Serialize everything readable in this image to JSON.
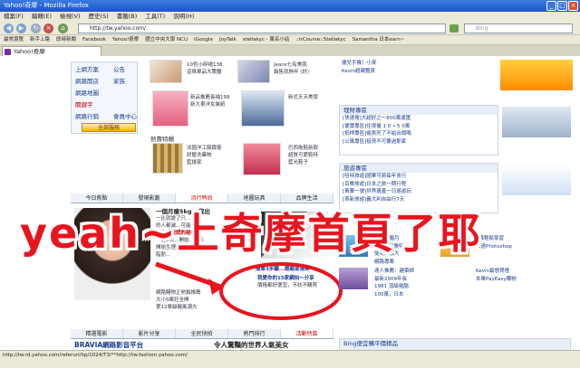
{
  "window": {
    "title": "Yahoo!奇摩 - Mozilla Firefox"
  },
  "menu": [
    "檔案(F)",
    "編輯(E)",
    "檢視(V)",
    "歷史(S)",
    "書籤(B)",
    "工具(T)",
    "說明(H)"
  ],
  "nav": {
    "url": "http://tw.yahoo.com/",
    "search_placeholder": "Bing"
  },
  "bookmarks": [
    "最常瀏覽",
    "新手上路",
    "即時新聞",
    "Facebook",
    "Yahoo!奇摩",
    "國立中央大學 NCU",
    "iGoogle",
    "JoyTalk",
    "stellakyc - 萬名小站",
    "::IrCourse::Stellakyc",
    "Samantha 日本earn~"
  ],
  "tab": {
    "label": "Yahoo!奇摩"
  },
  "leftnav": {
    "items": [
      "上網方案",
      "公告",
      "網路開店",
      "家族",
      "網路地圖",
      "關鍵字",
      "網路行銷",
      "會員中心",
      "全部服務"
    ]
  },
  "products": {
    "row1": [
      "10色小碎裙138",
      "這條單品大驚豔",
      "新款推薦138",
      "Jeans七有美肌",
      "銷售就夠年 (好)"
    ],
    "row2": [
      "新品推薦長袖199",
      "新大東洋女裝紙",
      "新式天天美學"
    ],
    "header": "熱賣特輯",
    "row3": [
      "法國洋工膜蹲靈",
      "紓壓洗藥物",
      "藍拔家",
      "日本小子紅品",
      "巴西拖鞋新款",
      "超質可愛鞋特",
      "藍光鞋子"
    ]
  },
  "section_tabs": [
    "今日焦點",
    "發現影劇",
    "流行時尚",
    "地圖玩具",
    "品牌生活"
  ],
  "feature": {
    "lines": [
      "一個月瘦5kg...我出",
      "一比就變了只…",
      "的人都減…可能",
      "美人不說謊的秘密",
      "一週2次…開始…每天",
      "開始生理…回憶",
      "脂肪…"
    ],
    "sub1": "網路購物正熱銷推薦",
    "sub2": "大小S瘋狂全開",
    "sub3": "第12單級戰風潮大",
    "pic_title": "簡單3步驟...輕鬆部落美",
    "pic_sub1": "我愛你的15家網拍～分享",
    "pic_sub2": "價格都好便宜，不妨不購買"
  },
  "right_boxes": [
    {
      "head": "理財專區",
      "lines": [
        "[快速搜]大超好之〜800萬運匯",
        "[便寶專區]住很優 1 0 • 5 0萬",
        "[抵押專區]電表死了不給出頭嗎",
        "[公寓專區]投資不可要過那家"
      ]
    },
    {
      "head": "旅遊專區",
      "lines": [
        "[哈特旅遊]國軍可將每年會行",
        "[百樂旅遊]日本之旅一期行程",
        "[黃賽一號]世界遺產一日遊遊玩",
        "[燕新旅遊]義大利自由行7天"
      ]
    },
    {
      "head": "",
      "lines": [
        "八月電腦月",
        "100種可樂特",
        "使用與最大",
        "網路專案"
      ]
    },
    {
      "head": "",
      "lines": [
        "達人推薦：建築師",
        "最新2009年長",
        "1981 頂級電腦",
        "100萬，日本"
      ]
    }
  ],
  "right_tags": [
    "捷兒手機！小麥",
    "Kevin超親鑑賞",
    "21天之期",
    "8歲輕鬆學習",
    "快速Photoshop",
    "Kevin最想賀禮",
    "本單PayEasy購物"
  ],
  "bottom_tabs": [
    "精選電影",
    "影片分享",
    "全民快拍",
    "熱門排行",
    "活動特區"
  ],
  "bottom_banner": {
    "left": "BRAVIA網路影音平台",
    "middle": "令人驚豔的世界人氣美女"
  },
  "right_bottom": "Bing便宜購平價精品",
  "overlay": "yeah~上奇摩首頁了耶",
  "status": "http://tw.rd.yahoo.com/referurl/hp/1024/T3/**http://tw.fashion.yahoo.com/"
}
